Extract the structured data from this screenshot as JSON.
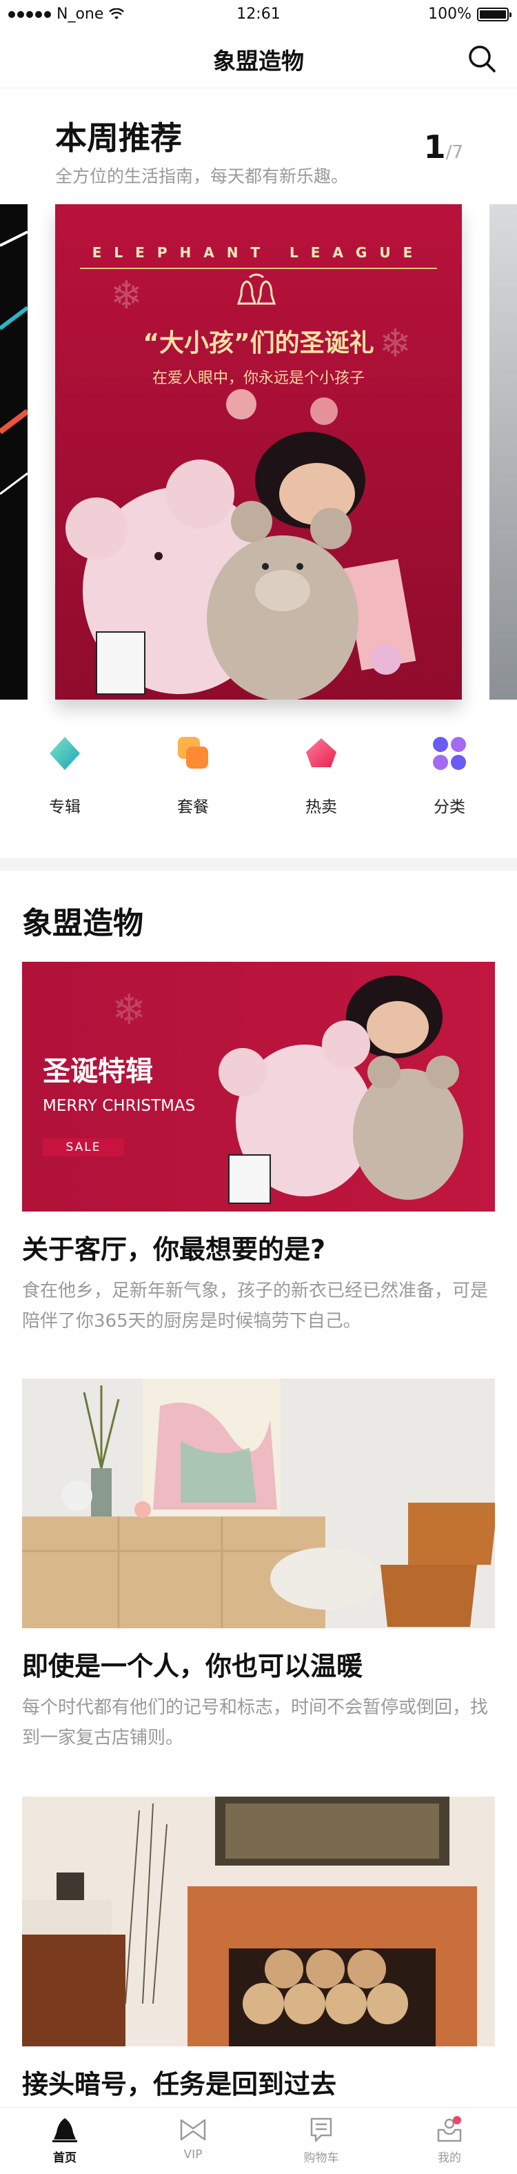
{
  "status_bar": {
    "carrier": "N_one",
    "time": "12:61",
    "battery": "100%"
  },
  "navbar": {
    "title": "象盟造物",
    "search_icon": "search-icon"
  },
  "weekly": {
    "title": "本周推荐",
    "subtitle": "全方位的生活指南，每天都有新乐趣。",
    "pager_current": "1",
    "pager_total": "/7",
    "hero": {
      "league": "ELEPHANT LEAGUE",
      "title": "“大小孩”们的圣诞礼",
      "subtitle": "在爱人眼中，你永远是个小孩子"
    }
  },
  "categories": [
    {
      "label": "专辑",
      "icon": "album-icon",
      "color": "#2fc0b8"
    },
    {
      "label": "套餐",
      "icon": "package-icon",
      "color": "#ff9a3a"
    },
    {
      "label": "热卖",
      "icon": "hot-sale-icon",
      "color": "#f0446c"
    },
    {
      "label": "分类",
      "icon": "category-grid-icon",
      "color": "#7b5cf5"
    }
  ],
  "section": {
    "title": "象盟造物"
  },
  "articles": [
    {
      "banner_title": "圣诞特辑",
      "banner_en": "MERRY CHRISTMAS",
      "banner_sale": "SALE",
      "title": "关于客厅，你最想要的是?",
      "desc": "食在他乡，足新年新气象，孩子的新衣已经已然准备，可是陪伴了你365天的厨房是时候犒劳下自己。"
    },
    {
      "title": "即使是一个人，你也可以温暖",
      "desc": "每个时代都有他们的记号和标志，时间不会暂停或倒回，找到一家复古店铺则。"
    },
    {
      "title": "接头暗号，任务是回到过去",
      "desc": ""
    }
  ],
  "tabbar": [
    {
      "label": "首页",
      "icon": "home-icon",
      "active": true
    },
    {
      "label": "VIP",
      "icon": "vip-bowtie-icon",
      "active": false
    },
    {
      "label": "购物车",
      "icon": "cart-icon",
      "active": false
    },
    {
      "label": "我的",
      "icon": "profile-icon",
      "active": false
    }
  ],
  "colors": {
    "hero_red": "#b8123b",
    "text_primary": "#111111",
    "text_secondary": "#9a9a9a",
    "badge_red": "#f0446c"
  }
}
